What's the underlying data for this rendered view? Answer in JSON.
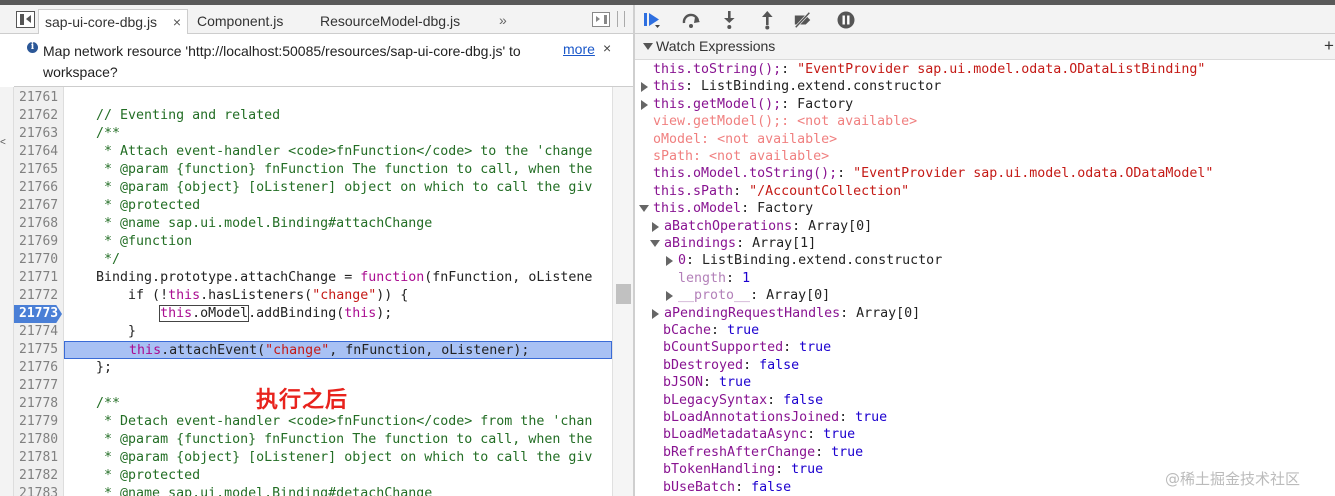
{
  "tabs": {
    "tab1": "sap-ui-core-dbg.js",
    "tab1_close": "×",
    "tab2": "Component.js",
    "tab3": "ResourceModel-dbg.js",
    "more": "»"
  },
  "infobar": {
    "icon": "i",
    "text": "Map network resource 'http://localhost:50085/resources/sap-ui-core-dbg.js' to workspace?",
    "more": "more",
    "close": "×"
  },
  "gutter_mark": "<",
  "editor": {
    "lines": [
      {
        "num": "21761",
        "code": ""
      },
      {
        "num": "21762",
        "code": "    // Eventing and related"
      },
      {
        "num": "21763",
        "code": "    /**"
      },
      {
        "num": "21764",
        "code": "     * Attach event-handler <code>fnFunction</code> to the 'change"
      },
      {
        "num": "21765",
        "code": "     * @param {function} fnFunction The function to call, when the"
      },
      {
        "num": "21766",
        "code": "     * @param {object} [oListener] object on which to call the giv"
      },
      {
        "num": "21767",
        "code": "     * @protected"
      },
      {
        "num": "21768",
        "code": "     * @name sap.ui.model.Binding#attachChange"
      },
      {
        "num": "21769",
        "code": "     * @function"
      },
      {
        "num": "21770",
        "code": "     */"
      },
      {
        "num": "21771",
        "pre": "    Binding.prototype.attachChange = ",
        "kw": "function",
        "post": "(fnFunction, oListene"
      },
      {
        "num": "21772",
        "pre": "        if (!",
        "kw": "this",
        "mid": ".hasListeners(",
        "str": "\"change\"",
        "post": ")) {"
      },
      {
        "num": "21773",
        "pre": "            ",
        "kw": "this",
        "boxed": "this.oModel",
        "mid": ".addBinding(",
        "kw2": "this",
        "post": ");"
      },
      {
        "num": "21774",
        "code": "        }"
      },
      {
        "num": "21775",
        "pre": "        ",
        "kw": "this",
        "mid": ".attachEvent(",
        "str": "\"change\"",
        "post": ", fnFunction, oListener);"
      },
      {
        "num": "21776",
        "code": "    };"
      },
      {
        "num": "21777",
        "code": ""
      },
      {
        "num": "21778",
        "code": "    /**"
      },
      {
        "num": "21779",
        "code": "     * Detach event-handler <code>fnFunction</code> from the 'chan"
      },
      {
        "num": "21780",
        "code": "     * @param {function} fnFunction The function to call, when the"
      },
      {
        "num": "21781",
        "code": "     * @param {object} [oListener] object on which to call the giv"
      },
      {
        "num": "21782",
        "code": "     * @protected"
      },
      {
        "num": "21783",
        "code": "     * @name sap.ui.model.Binding#detachChange"
      }
    ]
  },
  "annotation": "执行之后",
  "debugger": {
    "watch_title": "Watch Expressions",
    "add": "+",
    "resume_icon": "resume-icon",
    "step_over_icon": "step-over-icon",
    "step_into_icon": "step-into-icon",
    "step_out_icon": "step-out-icon",
    "deactivate_breakpoints_icon": "deactivate-breakpoints-icon",
    "pause_on_exceptions_icon": "pause-on-exceptions-icon"
  },
  "watch": [
    {
      "key": "this.toString();",
      "sep": ": ",
      "val": "\"EventProvider sap.ui.model.odata.ODataListBinding\"",
      "type": "string"
    },
    {
      "key": "this",
      "sep": ": ",
      "val": "ListBinding.extend.constructor",
      "type": "plain"
    },
    {
      "key": "this.getModel();",
      "sep": ": ",
      "val": "Factory",
      "type": "plain"
    },
    {
      "key": "view.getModel();",
      "sep": ": ",
      "val": "<not available>",
      "type": "na"
    },
    {
      "key": "oModel",
      "sep": ": ",
      "val": "<not available>",
      "type": "na"
    },
    {
      "key": "sPath",
      "sep": ": ",
      "val": "<not available>",
      "type": "na"
    },
    {
      "key": "this.oModel.toString();",
      "sep": ": ",
      "val": "\"EventProvider sap.ui.model.odata.ODataModel\"",
      "type": "string"
    },
    {
      "key": "this.sPath",
      "sep": ": ",
      "val": "\"/AccountCollection\"",
      "type": "string"
    },
    {
      "key": "this.oModel",
      "sep": ": ",
      "val": "Factory",
      "type": "plain"
    },
    {
      "key": "aBatchOperations",
      "sep": ": ",
      "val": "Array[0]",
      "type": "plain"
    },
    {
      "key": "aBindings",
      "sep": ": ",
      "val": "Array[1]",
      "type": "plain"
    },
    {
      "key": "0",
      "sep": ": ",
      "val": "ListBinding.extend.constructor",
      "type": "plain"
    },
    {
      "key": "length",
      "sep": ": ",
      "val": "1",
      "type": "num"
    },
    {
      "key": "__proto__",
      "sep": ": ",
      "val": "Array[0]",
      "type": "plain"
    },
    {
      "key": "aPendingRequestHandles",
      "sep": ": ",
      "val": "Array[0]",
      "type": "plain"
    },
    {
      "key": "bCache",
      "sep": ": ",
      "val": "true",
      "type": "bool"
    },
    {
      "key": "bCountSupported",
      "sep": ": ",
      "val": "true",
      "type": "bool"
    },
    {
      "key": "bDestroyed",
      "sep": ": ",
      "val": "false",
      "type": "bool"
    },
    {
      "key": "bJSON",
      "sep": ": ",
      "val": "true",
      "type": "bool"
    },
    {
      "key": "bLegacySyntax",
      "sep": ": ",
      "val": "false",
      "type": "bool"
    },
    {
      "key": "bLoadAnnotationsJoined",
      "sep": ": ",
      "val": "true",
      "type": "bool"
    },
    {
      "key": "bLoadMetadataAsync",
      "sep": ": ",
      "val": "true",
      "type": "bool"
    },
    {
      "key": "bRefreshAfterChange",
      "sep": ": ",
      "val": "true",
      "type": "bool"
    },
    {
      "key": "bTokenHandling",
      "sep": ": ",
      "val": "true",
      "type": "bool"
    },
    {
      "key": "bUseBatch",
      "sep": ": ",
      "val": "false",
      "type": "bool"
    }
  ],
  "watermark": "@稀土掘金技术社区"
}
